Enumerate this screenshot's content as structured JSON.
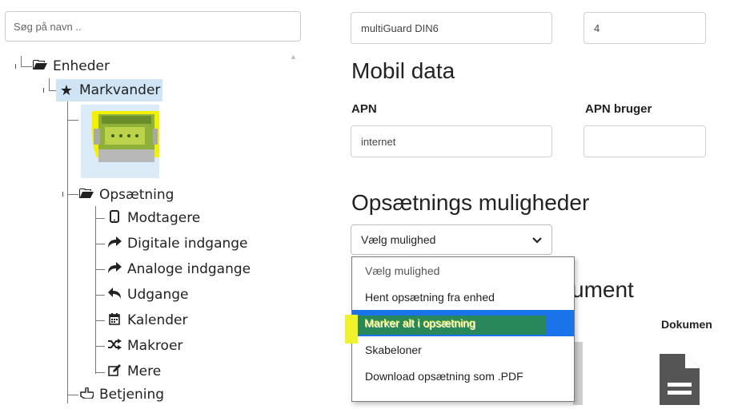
{
  "search": {
    "placeholder": "Søg på navn .."
  },
  "tree": {
    "root": {
      "label": "Enheder",
      "icon": "folder-open-icon"
    },
    "device": {
      "label": "Markvander",
      "icon": "star-icon"
    },
    "setup": {
      "label": "Opsætning",
      "icon": "folder-open-icon"
    },
    "setup_items": [
      {
        "label": "Modtagere",
        "icon": "mobile-phone-icon"
      },
      {
        "label": "Digitale indgange",
        "icon": "share-arrow-icon"
      },
      {
        "label": "Analoge indgange",
        "icon": "share-arrow-icon"
      },
      {
        "label": "Udgange",
        "icon": "reply-arrow-icon"
      },
      {
        "label": "Kalender",
        "icon": "calendar-icon"
      },
      {
        "label": "Makroer",
        "icon": "shuffle-icon"
      },
      {
        "label": "Mere",
        "icon": "edit-icon"
      }
    ],
    "operation": {
      "label": "Betjening",
      "icon": "hand-pointer-icon"
    }
  },
  "form": {
    "model_value": "multiGuard DIN6",
    "number_value": "4",
    "mobile_heading": "Mobil data",
    "apn_label": "APN",
    "apn_value": "internet",
    "apn_user_label": "APN bruger",
    "apn_user_value": "",
    "setup_heading": "Opsætnings muligheder",
    "documents_heading_partial": "ument",
    "documents_label_partial": "Dokumen"
  },
  "select": {
    "value": "Vælg mulighed",
    "options": [
      "Vælg mulighed",
      "Hent opsætning fra enhed",
      "Marker alt i opsætning",
      "Skabeloner",
      "Download opsætning som .PDF"
    ]
  },
  "colors": {
    "accent": "#1a73e8",
    "selected_bg": "#cfe5f6",
    "highlight_yellow": "#f1f32a",
    "highlight_green": "#2f8f2a"
  }
}
